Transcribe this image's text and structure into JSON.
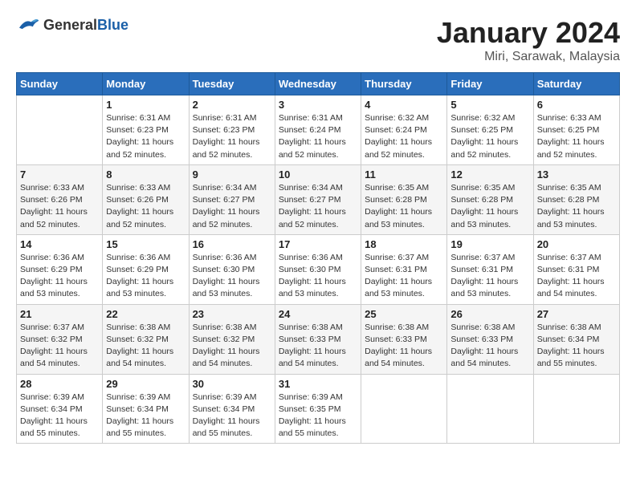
{
  "header": {
    "logo_general": "General",
    "logo_blue": "Blue",
    "month_title": "January 2024",
    "location": "Miri, Sarawak, Malaysia"
  },
  "weekdays": [
    "Sunday",
    "Monday",
    "Tuesday",
    "Wednesday",
    "Thursday",
    "Friday",
    "Saturday"
  ],
  "weeks": [
    [
      {
        "day": "",
        "sunrise": "",
        "sunset": "",
        "daylight": ""
      },
      {
        "day": "1",
        "sunrise": "6:31 AM",
        "sunset": "6:23 PM",
        "daylight": "11 hours and 52 minutes."
      },
      {
        "day": "2",
        "sunrise": "6:31 AM",
        "sunset": "6:23 PM",
        "daylight": "11 hours and 52 minutes."
      },
      {
        "day": "3",
        "sunrise": "6:31 AM",
        "sunset": "6:24 PM",
        "daylight": "11 hours and 52 minutes."
      },
      {
        "day": "4",
        "sunrise": "6:32 AM",
        "sunset": "6:24 PM",
        "daylight": "11 hours and 52 minutes."
      },
      {
        "day": "5",
        "sunrise": "6:32 AM",
        "sunset": "6:25 PM",
        "daylight": "11 hours and 52 minutes."
      },
      {
        "day": "6",
        "sunrise": "6:33 AM",
        "sunset": "6:25 PM",
        "daylight": "11 hours and 52 minutes."
      }
    ],
    [
      {
        "day": "7",
        "sunrise": "6:33 AM",
        "sunset": "6:26 PM",
        "daylight": "11 hours and 52 minutes."
      },
      {
        "day": "8",
        "sunrise": "6:33 AM",
        "sunset": "6:26 PM",
        "daylight": "11 hours and 52 minutes."
      },
      {
        "day": "9",
        "sunrise": "6:34 AM",
        "sunset": "6:27 PM",
        "daylight": "11 hours and 52 minutes."
      },
      {
        "day": "10",
        "sunrise": "6:34 AM",
        "sunset": "6:27 PM",
        "daylight": "11 hours and 52 minutes."
      },
      {
        "day": "11",
        "sunrise": "6:35 AM",
        "sunset": "6:28 PM",
        "daylight": "11 hours and 53 minutes."
      },
      {
        "day": "12",
        "sunrise": "6:35 AM",
        "sunset": "6:28 PM",
        "daylight": "11 hours and 53 minutes."
      },
      {
        "day": "13",
        "sunrise": "6:35 AM",
        "sunset": "6:28 PM",
        "daylight": "11 hours and 53 minutes."
      }
    ],
    [
      {
        "day": "14",
        "sunrise": "6:36 AM",
        "sunset": "6:29 PM",
        "daylight": "11 hours and 53 minutes."
      },
      {
        "day": "15",
        "sunrise": "6:36 AM",
        "sunset": "6:29 PM",
        "daylight": "11 hours and 53 minutes."
      },
      {
        "day": "16",
        "sunrise": "6:36 AM",
        "sunset": "6:30 PM",
        "daylight": "11 hours and 53 minutes."
      },
      {
        "day": "17",
        "sunrise": "6:36 AM",
        "sunset": "6:30 PM",
        "daylight": "11 hours and 53 minutes."
      },
      {
        "day": "18",
        "sunrise": "6:37 AM",
        "sunset": "6:31 PM",
        "daylight": "11 hours and 53 minutes."
      },
      {
        "day": "19",
        "sunrise": "6:37 AM",
        "sunset": "6:31 PM",
        "daylight": "11 hours and 53 minutes."
      },
      {
        "day": "20",
        "sunrise": "6:37 AM",
        "sunset": "6:31 PM",
        "daylight": "11 hours and 54 minutes."
      }
    ],
    [
      {
        "day": "21",
        "sunrise": "6:37 AM",
        "sunset": "6:32 PM",
        "daylight": "11 hours and 54 minutes."
      },
      {
        "day": "22",
        "sunrise": "6:38 AM",
        "sunset": "6:32 PM",
        "daylight": "11 hours and 54 minutes."
      },
      {
        "day": "23",
        "sunrise": "6:38 AM",
        "sunset": "6:32 PM",
        "daylight": "11 hours and 54 minutes."
      },
      {
        "day": "24",
        "sunrise": "6:38 AM",
        "sunset": "6:33 PM",
        "daylight": "11 hours and 54 minutes."
      },
      {
        "day": "25",
        "sunrise": "6:38 AM",
        "sunset": "6:33 PM",
        "daylight": "11 hours and 54 minutes."
      },
      {
        "day": "26",
        "sunrise": "6:38 AM",
        "sunset": "6:33 PM",
        "daylight": "11 hours and 54 minutes."
      },
      {
        "day": "27",
        "sunrise": "6:38 AM",
        "sunset": "6:34 PM",
        "daylight": "11 hours and 55 minutes."
      }
    ],
    [
      {
        "day": "28",
        "sunrise": "6:39 AM",
        "sunset": "6:34 PM",
        "daylight": "11 hours and 55 minutes."
      },
      {
        "day": "29",
        "sunrise": "6:39 AM",
        "sunset": "6:34 PM",
        "daylight": "11 hours and 55 minutes."
      },
      {
        "day": "30",
        "sunrise": "6:39 AM",
        "sunset": "6:34 PM",
        "daylight": "11 hours and 55 minutes."
      },
      {
        "day": "31",
        "sunrise": "6:39 AM",
        "sunset": "6:35 PM",
        "daylight": "11 hours and 55 minutes."
      },
      {
        "day": "",
        "sunrise": "",
        "sunset": "",
        "daylight": ""
      },
      {
        "day": "",
        "sunrise": "",
        "sunset": "",
        "daylight": ""
      },
      {
        "day": "",
        "sunrise": "",
        "sunset": "",
        "daylight": ""
      }
    ]
  ]
}
